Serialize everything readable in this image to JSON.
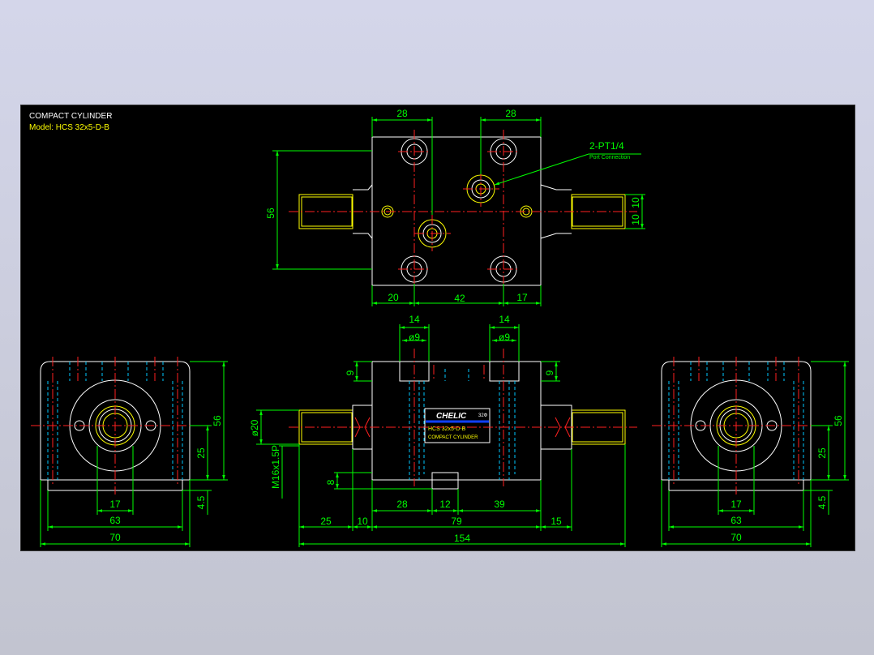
{
  "title": {
    "line1": "COMPACT CYLINDER",
    "line2": "Model: HCS 32x5-D-B"
  },
  "callout": {
    "label": "2-PT1/4",
    "sub": "Port Connection"
  },
  "nameplate": {
    "brand": "CHELIC",
    "bore": "32Ф",
    "model": "HCS 32x5-D-B",
    "desc": "COMPACT CYLINDER"
  },
  "dims": {
    "top_28a": "28",
    "top_28b": "28",
    "top_56": "56",
    "top_10a": "10",
    "top_10b": "10",
    "top_20": "20",
    "top_42": "42",
    "top_17": "17",
    "front_14a": "14",
    "front_14b": "14",
    "front_d9a": "ø9",
    "front_d9b": "ø9",
    "front_9a": "9",
    "front_9b": "9",
    "front_d20": "ø20",
    "front_m16": "M16x1.5P",
    "front_8": "8",
    "front_25": "25",
    "front_10": "10",
    "front_28": "28",
    "front_12": "12",
    "front_79": "79",
    "front_39": "39",
    "front_15": "15",
    "front_154": "154",
    "side_17": "17",
    "side_63": "63",
    "side_70": "70",
    "side_56": "56",
    "side_25": "25",
    "side_45": "4.5"
  },
  "colors": {
    "background": "#000000",
    "outline": "#ffffff",
    "dimension": "#00ff00",
    "centerline": "#ff2020",
    "hidden": "#00c8ff",
    "highlight": "#ffff00",
    "plate_blue": "#1040ff"
  }
}
